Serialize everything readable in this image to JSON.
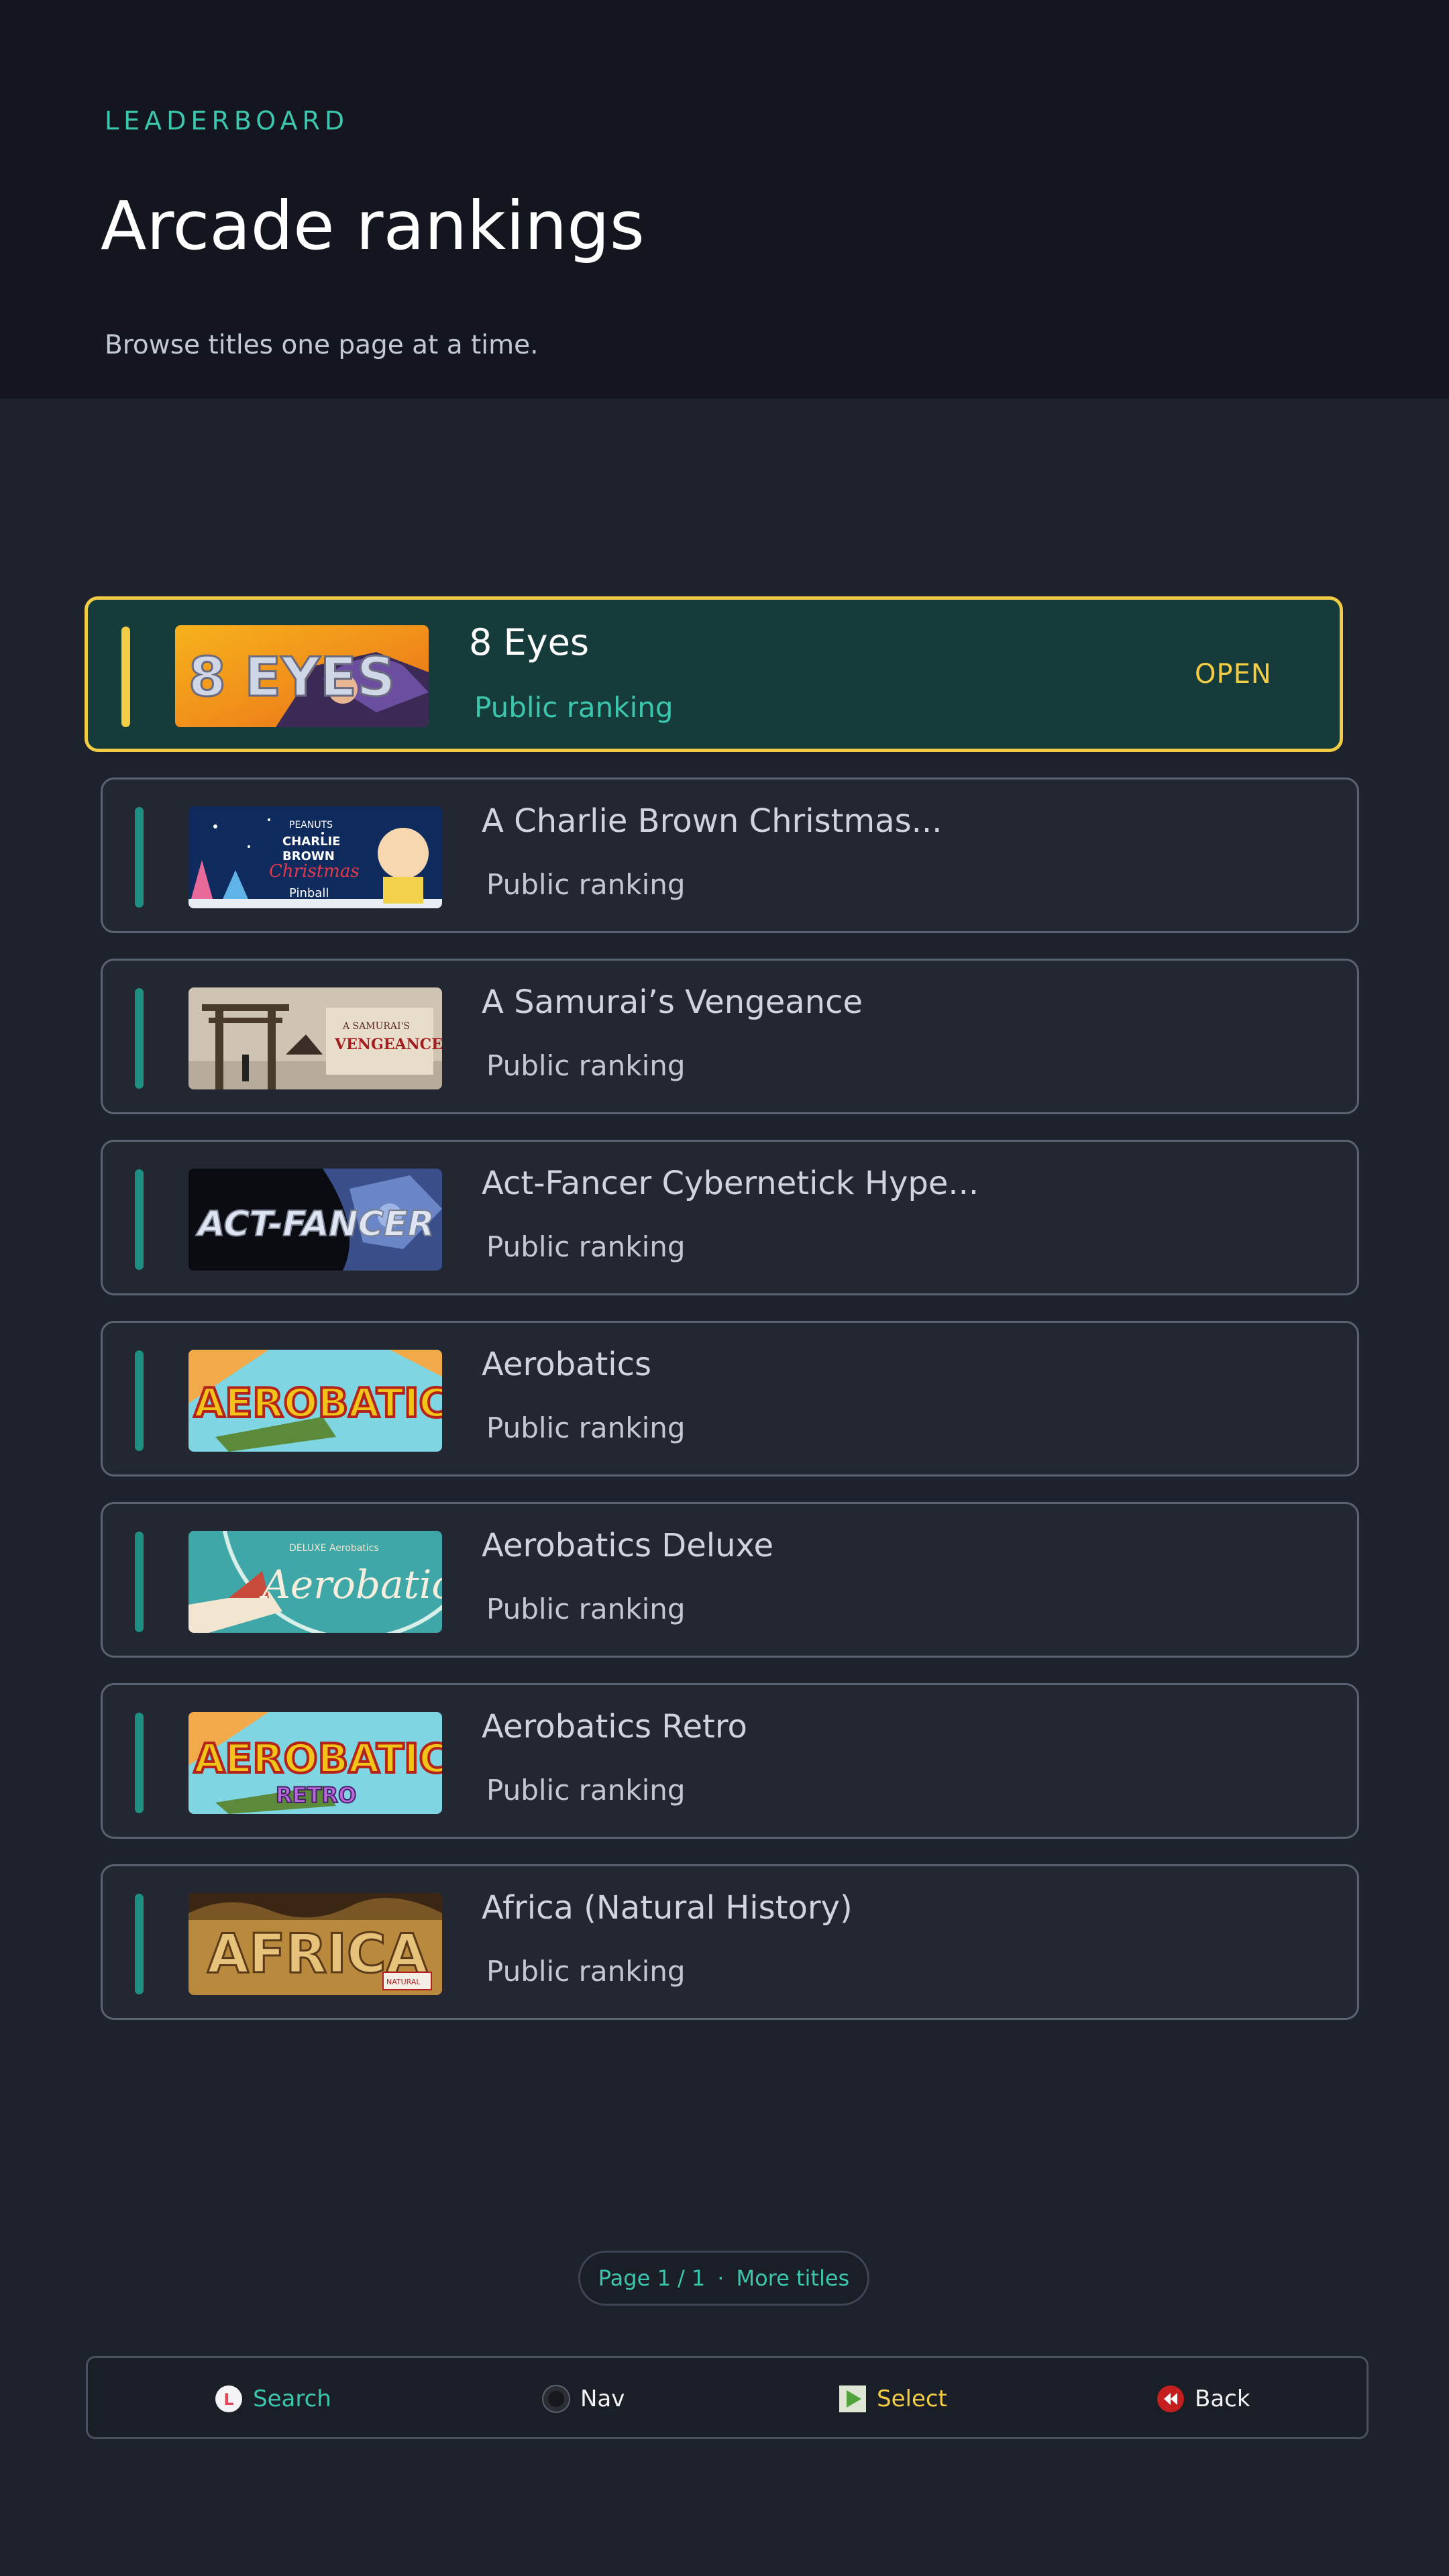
{
  "header": {
    "eyebrow": "LEADERBOARD",
    "title": "Arcade rankings",
    "subtitle": "Browse titles one page at a time."
  },
  "colors": {
    "accent": "#3cc6ad",
    "highlight": "#f2cc45",
    "active_bg": "#153b3b",
    "row_bg": "#232732"
  },
  "selected": {
    "name": "8 Eyes",
    "status": "Public ranking",
    "action": "OPEN"
  },
  "rows": [
    {
      "name": "A Charlie Brown Christmas...",
      "status": "Public ranking"
    },
    {
      "name": "A Samurai’s Vengeance",
      "status": "Public ranking"
    },
    {
      "name": "Act-Fancer Cybernetick Hype...",
      "status": "Public ranking"
    },
    {
      "name": "Aerobatics",
      "status": "Public ranking"
    },
    {
      "name": "Aerobatics Deluxe",
      "status": "Public ranking"
    },
    {
      "name": "Aerobatics Retro",
      "status": "Public ranking"
    },
    {
      "name": "Africa (Natural History)",
      "status": "Public ranking"
    }
  ],
  "pager": {
    "page": "Page 1 / 1",
    "more": "More titles"
  },
  "footer": {
    "search": {
      "label": "Search",
      "icon": "l-button-icon"
    },
    "nav": {
      "label": "Nav",
      "icon": "dpad-icon"
    },
    "select": {
      "label": "Select",
      "icon": "play-icon"
    },
    "back": {
      "label": "Back",
      "icon": "rewind-icon"
    }
  },
  "thumb_texts": {
    "eight_eyes": "8 EYES",
    "charlie_brown": "PEANUTS A CHARLIE BROWN Christmas Pinball",
    "samurai": "A SAMURAI'S VENGEANCE",
    "act_fancer": "ACT-FANCER",
    "aerobatics": "AEROBATICS",
    "aerobatics_deluxe": "DELUXE Aerobatics",
    "aerobatics_retro": "AEROBATICS RETRO",
    "africa": "AFRICA NATURAL HISTORY"
  }
}
